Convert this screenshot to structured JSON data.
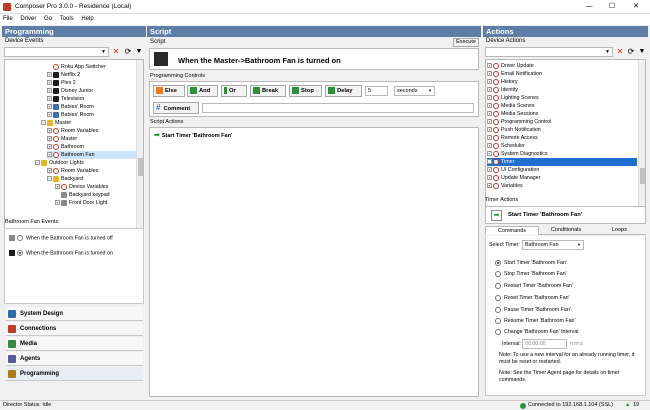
{
  "window": {
    "title": "Composer Pro 3.0.0 - Residence (Local)",
    "minimize": "—",
    "maximize": "☐",
    "close": "✕"
  },
  "menu": [
    "File",
    "Driver",
    "Go",
    "Tools",
    "Help"
  ],
  "left": {
    "header": "Programming",
    "device_events_label": "Device Events",
    "tree": [
      {
        "label": "Roku App Switcher",
        "icon": "red-driver-icon"
      },
      {
        "label": "Netflix 2",
        "icon": "tv-icon"
      },
      {
        "label": "Plex 2",
        "icon": "tv-icon"
      },
      {
        "label": "Disney Junior",
        "icon": "tv-icon"
      },
      {
        "label": "Television",
        "icon": "tv-icon"
      },
      {
        "label": "Babies' Room",
        "icon": "blue-room-icon"
      },
      {
        "label": "Babies' Room",
        "icon": "blue-room-icon"
      },
      {
        "label": "Master",
        "icon": "yellow-room-icon"
      },
      {
        "label": "Room Variables",
        "icon": "red-driver-icon"
      },
      {
        "label": "Master",
        "icon": "red-driver-icon"
      },
      {
        "label": "Bathroom",
        "icon": "red-driver-icon"
      },
      {
        "label": "Bathroom Fan",
        "icon": "red-driver-icon"
      },
      {
        "label": "Outdoor Lights",
        "icon": "yellow-room-icon"
      },
      {
        "label": "Room Variables",
        "icon": "red-driver-icon"
      },
      {
        "label": "Backyard",
        "icon": "yellow-room-icon"
      },
      {
        "label": "Device Variables",
        "icon": "red-driver-icon"
      },
      {
        "label": "Backyard keypad",
        "icon": "gray-keypad-icon"
      },
      {
        "label": "Front Door Light",
        "icon": "gray-keypad-icon"
      }
    ],
    "events_header": "Bathroom Fan Events",
    "events": [
      {
        "label": "When the Bathroom Fan is turned off",
        "selected": false
      },
      {
        "label": "When the Bathroom Fan is turned on",
        "selected": true
      }
    ],
    "nav": [
      {
        "label": "System Design",
        "color": "#2b6cb0"
      },
      {
        "label": "Connections",
        "color": "#c0392b"
      },
      {
        "label": "Media",
        "color": "#2d8f3e"
      },
      {
        "label": "Agents",
        "color": "#5a5aa0"
      },
      {
        "label": "Programming",
        "color": "#b07a1a"
      }
    ]
  },
  "center": {
    "header": "Script",
    "script_label": "Script",
    "execute": "Execute",
    "event_title": "When the Master->Bathroom Fan is turned on",
    "controls_label": "Programming Controls",
    "controls": {
      "else": "Else",
      "and": "And",
      "or": "Or",
      "break": "Break",
      "stop": "Stop",
      "delay": "Delay",
      "delay_value": "5",
      "delay_unit": "seconds",
      "comment": "Comment"
    },
    "actions_label": "Script Actions",
    "actions": [
      "Start Timer 'Bathroom Fan'"
    ]
  },
  "right": {
    "header": "Actions",
    "device_actions_label": "Device Actions",
    "tree": [
      "Driver Update",
      "Email Notification",
      "History",
      "Identity",
      "Lighting Scenes",
      "Media Scenes",
      "Media Sessions",
      "Programming Control",
      "Push Notification",
      "Remote Access",
      "Scheduler",
      "System Diagnostics",
      "Timer",
      "UI Configuration",
      "Update Manager",
      "Variables"
    ],
    "selected_index": 12,
    "timer_actions_label": "Timer Actions",
    "timer_action": "Start Timer 'Bathroom Fan'",
    "tabs": [
      "Commands",
      "Conditionals",
      "Loops"
    ],
    "select_timer_label": "Select Timer:",
    "select_timer_value": "Bathroom Fan",
    "options": [
      {
        "label": "Start Timer 'Bathroom Fan'",
        "selected": true
      },
      {
        "label": "Stop Timer 'Bathroom Fan'",
        "selected": false
      },
      {
        "label": "Restart Timer 'Bathroom Fan'",
        "selected": false
      },
      {
        "label": "Reset Timer 'Bathroom Fan'",
        "selected": false
      },
      {
        "label": "Pause Timer 'Bathroom Fan'",
        "selected": false
      },
      {
        "label": "Resume Timer 'Bathroom Fan'",
        "selected": false
      },
      {
        "label": "Change 'Bathroom Fan' Interval",
        "selected": false
      }
    ],
    "interval_label": "Interval:",
    "interval_value": "00:00.00",
    "interval_units": "h:m:s",
    "note1": "Note: To use a new interval for an already running timer, it must be reset or restarted.",
    "note2": "Note: See the Timer Agent page for details on timer commands."
  },
  "status": {
    "left": "Director Status: Idle",
    "connection": "Connected to 192.168.1.104 (SSL)",
    "updates": "19"
  }
}
